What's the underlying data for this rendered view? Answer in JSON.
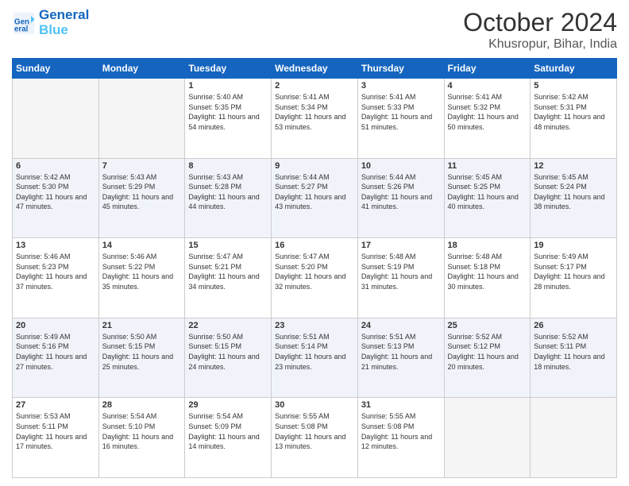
{
  "header": {
    "logo_line1": "General",
    "logo_line2": "Blue",
    "month": "October 2024",
    "location": "Khusropur, Bihar, India"
  },
  "weekdays": [
    "Sunday",
    "Monday",
    "Tuesday",
    "Wednesday",
    "Thursday",
    "Friday",
    "Saturday"
  ],
  "weeks": [
    [
      {
        "day": "",
        "sunrise": "",
        "sunset": "",
        "daylight": "",
        "empty": true
      },
      {
        "day": "",
        "sunrise": "",
        "sunset": "",
        "daylight": "",
        "empty": true
      },
      {
        "day": "1",
        "sunrise": "Sunrise: 5:40 AM",
        "sunset": "Sunset: 5:35 PM",
        "daylight": "Daylight: 11 hours and 54 minutes.",
        "empty": false
      },
      {
        "day": "2",
        "sunrise": "Sunrise: 5:41 AM",
        "sunset": "Sunset: 5:34 PM",
        "daylight": "Daylight: 11 hours and 53 minutes.",
        "empty": false
      },
      {
        "day": "3",
        "sunrise": "Sunrise: 5:41 AM",
        "sunset": "Sunset: 5:33 PM",
        "daylight": "Daylight: 11 hours and 51 minutes.",
        "empty": false
      },
      {
        "day": "4",
        "sunrise": "Sunrise: 5:41 AM",
        "sunset": "Sunset: 5:32 PM",
        "daylight": "Daylight: 11 hours and 50 minutes.",
        "empty": false
      },
      {
        "day": "5",
        "sunrise": "Sunrise: 5:42 AM",
        "sunset": "Sunset: 5:31 PM",
        "daylight": "Daylight: 11 hours and 48 minutes.",
        "empty": false
      }
    ],
    [
      {
        "day": "6",
        "sunrise": "Sunrise: 5:42 AM",
        "sunset": "Sunset: 5:30 PM",
        "daylight": "Daylight: 11 hours and 47 minutes.",
        "empty": false
      },
      {
        "day": "7",
        "sunrise": "Sunrise: 5:43 AM",
        "sunset": "Sunset: 5:29 PM",
        "daylight": "Daylight: 11 hours and 45 minutes.",
        "empty": false
      },
      {
        "day": "8",
        "sunrise": "Sunrise: 5:43 AM",
        "sunset": "Sunset: 5:28 PM",
        "daylight": "Daylight: 11 hours and 44 minutes.",
        "empty": false
      },
      {
        "day": "9",
        "sunrise": "Sunrise: 5:44 AM",
        "sunset": "Sunset: 5:27 PM",
        "daylight": "Daylight: 11 hours and 43 minutes.",
        "empty": false
      },
      {
        "day": "10",
        "sunrise": "Sunrise: 5:44 AM",
        "sunset": "Sunset: 5:26 PM",
        "daylight": "Daylight: 11 hours and 41 minutes.",
        "empty": false
      },
      {
        "day": "11",
        "sunrise": "Sunrise: 5:45 AM",
        "sunset": "Sunset: 5:25 PM",
        "daylight": "Daylight: 11 hours and 40 minutes.",
        "empty": false
      },
      {
        "day": "12",
        "sunrise": "Sunrise: 5:45 AM",
        "sunset": "Sunset: 5:24 PM",
        "daylight": "Daylight: 11 hours and 38 minutes.",
        "empty": false
      }
    ],
    [
      {
        "day": "13",
        "sunrise": "Sunrise: 5:46 AM",
        "sunset": "Sunset: 5:23 PM",
        "daylight": "Daylight: 11 hours and 37 minutes.",
        "empty": false
      },
      {
        "day": "14",
        "sunrise": "Sunrise: 5:46 AM",
        "sunset": "Sunset: 5:22 PM",
        "daylight": "Daylight: 11 hours and 35 minutes.",
        "empty": false
      },
      {
        "day": "15",
        "sunrise": "Sunrise: 5:47 AM",
        "sunset": "Sunset: 5:21 PM",
        "daylight": "Daylight: 11 hours and 34 minutes.",
        "empty": false
      },
      {
        "day": "16",
        "sunrise": "Sunrise: 5:47 AM",
        "sunset": "Sunset: 5:20 PM",
        "daylight": "Daylight: 11 hours and 32 minutes.",
        "empty": false
      },
      {
        "day": "17",
        "sunrise": "Sunrise: 5:48 AM",
        "sunset": "Sunset: 5:19 PM",
        "daylight": "Daylight: 11 hours and 31 minutes.",
        "empty": false
      },
      {
        "day": "18",
        "sunrise": "Sunrise: 5:48 AM",
        "sunset": "Sunset: 5:18 PM",
        "daylight": "Daylight: 11 hours and 30 minutes.",
        "empty": false
      },
      {
        "day": "19",
        "sunrise": "Sunrise: 5:49 AM",
        "sunset": "Sunset: 5:17 PM",
        "daylight": "Daylight: 11 hours and 28 minutes.",
        "empty": false
      }
    ],
    [
      {
        "day": "20",
        "sunrise": "Sunrise: 5:49 AM",
        "sunset": "Sunset: 5:16 PM",
        "daylight": "Daylight: 11 hours and 27 minutes.",
        "empty": false
      },
      {
        "day": "21",
        "sunrise": "Sunrise: 5:50 AM",
        "sunset": "Sunset: 5:15 PM",
        "daylight": "Daylight: 11 hours and 25 minutes.",
        "empty": false
      },
      {
        "day": "22",
        "sunrise": "Sunrise: 5:50 AM",
        "sunset": "Sunset: 5:15 PM",
        "daylight": "Daylight: 11 hours and 24 minutes.",
        "empty": false
      },
      {
        "day": "23",
        "sunrise": "Sunrise: 5:51 AM",
        "sunset": "Sunset: 5:14 PM",
        "daylight": "Daylight: 11 hours and 23 minutes.",
        "empty": false
      },
      {
        "day": "24",
        "sunrise": "Sunrise: 5:51 AM",
        "sunset": "Sunset: 5:13 PM",
        "daylight": "Daylight: 11 hours and 21 minutes.",
        "empty": false
      },
      {
        "day": "25",
        "sunrise": "Sunrise: 5:52 AM",
        "sunset": "Sunset: 5:12 PM",
        "daylight": "Daylight: 11 hours and 20 minutes.",
        "empty": false
      },
      {
        "day": "26",
        "sunrise": "Sunrise: 5:52 AM",
        "sunset": "Sunset: 5:11 PM",
        "daylight": "Daylight: 11 hours and 18 minutes.",
        "empty": false
      }
    ],
    [
      {
        "day": "27",
        "sunrise": "Sunrise: 5:53 AM",
        "sunset": "Sunset: 5:11 PM",
        "daylight": "Daylight: 11 hours and 17 minutes.",
        "empty": false
      },
      {
        "day": "28",
        "sunrise": "Sunrise: 5:54 AM",
        "sunset": "Sunset: 5:10 PM",
        "daylight": "Daylight: 11 hours and 16 minutes.",
        "empty": false
      },
      {
        "day": "29",
        "sunrise": "Sunrise: 5:54 AM",
        "sunset": "Sunset: 5:09 PM",
        "daylight": "Daylight: 11 hours and 14 minutes.",
        "empty": false
      },
      {
        "day": "30",
        "sunrise": "Sunrise: 5:55 AM",
        "sunset": "Sunset: 5:08 PM",
        "daylight": "Daylight: 11 hours and 13 minutes.",
        "empty": false
      },
      {
        "day": "31",
        "sunrise": "Sunrise: 5:55 AM",
        "sunset": "Sunset: 5:08 PM",
        "daylight": "Daylight: 11 hours and 12 minutes.",
        "empty": false
      },
      {
        "day": "",
        "sunrise": "",
        "sunset": "",
        "daylight": "",
        "empty": true
      },
      {
        "day": "",
        "sunrise": "",
        "sunset": "",
        "daylight": "",
        "empty": true
      }
    ]
  ]
}
